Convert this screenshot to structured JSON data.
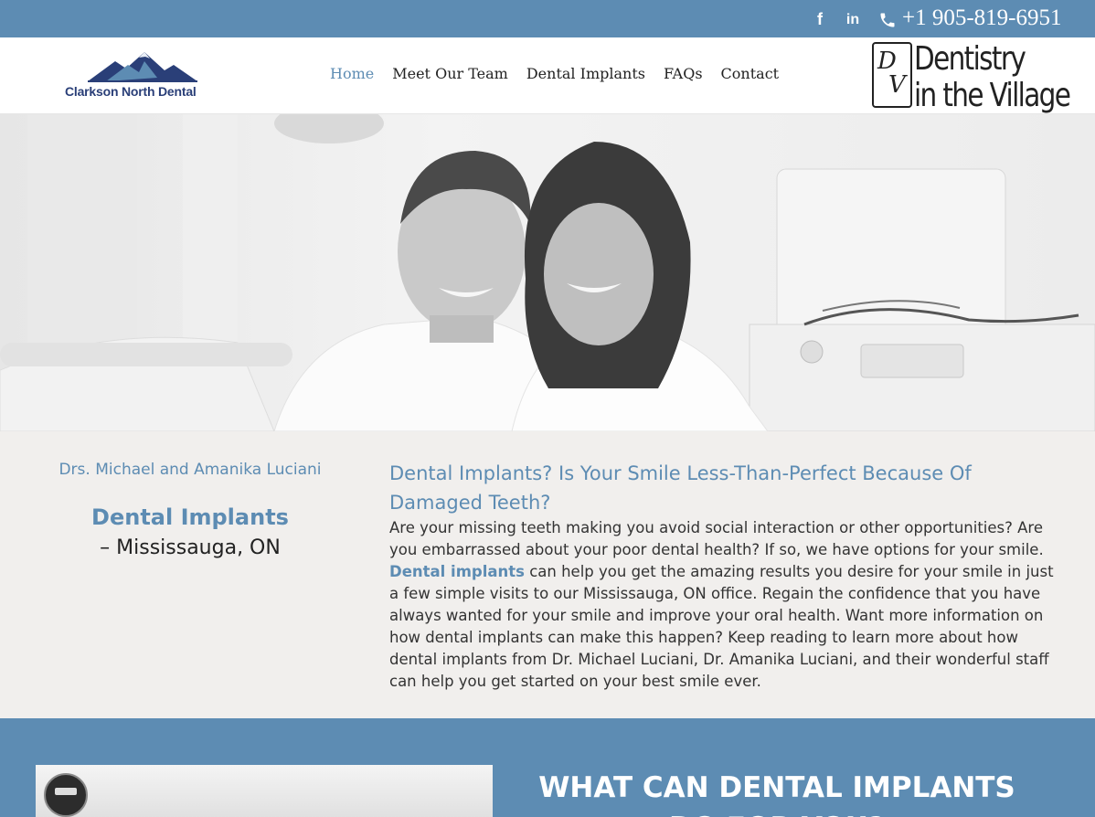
{
  "topbar": {
    "social_facebook": "f",
    "social_linkedin": "in",
    "phone": "+1 905-819-6951",
    "icons": [
      "facebook-icon",
      "linkedin-icon",
      "phone-icon"
    ],
    "text_color": "#ffffff",
    "background": "#5d8cb3"
  },
  "header": {
    "logo_left_text": "Clarkson North Dental",
    "nav": [
      {
        "label": "Home",
        "active": true
      },
      {
        "label": "Meet Our Team",
        "active": false
      },
      {
        "label": "Dental Implants",
        "active": false
      },
      {
        "label": "FAQs",
        "active": false
      },
      {
        "label": "Contact",
        "active": false
      }
    ],
    "logo_right_monogram_d": "D",
    "logo_right_monogram_v": "V",
    "logo_right_line1": "Dentistry",
    "logo_right_line2": "in the Village"
  },
  "intro": {
    "doctors": "Drs. Michael and Amanika Luciani",
    "left_title": "Dental Implants",
    "left_subtitle": "– Mississauga, ON",
    "heading": "Dental Implants? Is Your Smile Less-Than-Perfect Because Of Damaged Teeth?",
    "para_before": "Are your missing teeth making you avoid social interaction or other opportunities? Are you embarrassed about your poor dental health? If so, we have options for your smile. ",
    "para_link": "Dental implants",
    "para_after": " can help you get the amazing results you desire for your smile in just a few simple visits to our Mississauga, ON office. Regain the confidence that you have always wanted for your smile and improve your oral health. Want more information on how dental implants can make this happen? Keep reading to learn more about how dental implants from Dr. Michael Luciani, Dr. Amanika Luciani, and their wonderful staff can help you get started on your best smile ever."
  },
  "bottom": {
    "heading": "WHAT CAN DENTAL IMPLANTS DO FOR YOU?"
  },
  "colors": {
    "accent": "#5d8cb3",
    "body_text": "#333333",
    "section_bg": "#f1efed"
  }
}
